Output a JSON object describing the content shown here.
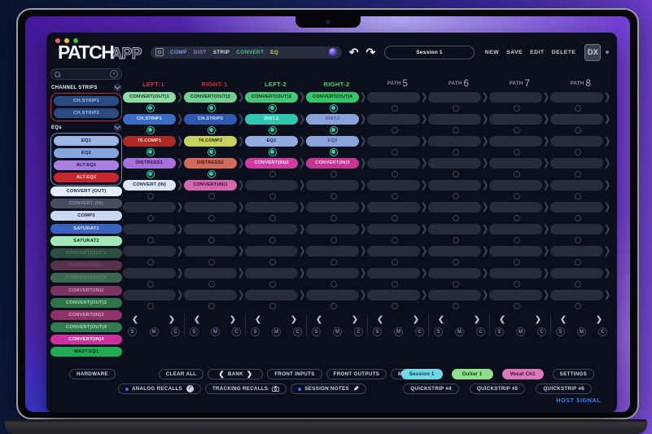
{
  "window": {
    "traffic_lights": [
      "#ff5f57",
      "#febc2e",
      "#28c840"
    ]
  },
  "icons": {
    "undo": "↶",
    "redo": "↷",
    "prev": "❮",
    "next": "❯",
    "clear_x": "✕",
    "pencil": "✎"
  },
  "header": {
    "logo_main": "PATCH",
    "logo_sub": "APP",
    "filter": {
      "tabs": [
        {
          "label": "COMP",
          "color": "#7f9ae6"
        },
        {
          "label": "DIST",
          "color": "#a86ae0"
        },
        {
          "label": "STRIP",
          "color": "#d2dee6"
        },
        {
          "label": "CONVERT",
          "color": "#3fc977"
        },
        {
          "label": "EQ",
          "color": "#d6d052"
        }
      ]
    },
    "session_name": "Session 1",
    "actions": [
      "NEW",
      "SAVE",
      "EDIT",
      "DELETE"
    ],
    "badge": "DX"
  },
  "sidebar": {
    "search_value": "",
    "groups": [
      {
        "label": "CHANNEL STRIPS",
        "border": "#b2333e",
        "items": [
          {
            "label": "CH.STRIP1",
            "bg": "#2b4a80",
            "fg": "#aabce0"
          },
          {
            "label": "CH.STRIP2",
            "bg": "#2b4a80",
            "fg": "#aabce0"
          }
        ]
      },
      {
        "label": "EQs",
        "border": "#6d87c8",
        "items": [
          {
            "label": "EQ1",
            "bg": "#9cb6e8",
            "fg": "#141c30"
          },
          {
            "label": "EQ2",
            "bg": "#88a4dc",
            "fg": "#141c30"
          },
          {
            "label": "ALT.EQ1",
            "bg": "#a77fe0",
            "fg": "#20103a"
          },
          {
            "label": "ALT.EQ2",
            "bg": "#c2282e",
            "fg": "#ffe2e2"
          }
        ]
      }
    ],
    "items": [
      {
        "label": "CONVERT (OUT)",
        "bg": "#e6ecfa",
        "fg": "#1a2030"
      },
      {
        "label": "CONVERT (IN)",
        "bg": "#474c5e",
        "fg": "#8a90a4"
      },
      {
        "label": "COMP2",
        "bg": "#ccd8f2",
        "fg": "#1a2030"
      },
      {
        "label": "SATURAT1",
        "bg": "#3a62c2",
        "fg": "#e8eeff"
      },
      {
        "label": "SATURAT2",
        "bg": "#a2e8b8",
        "fg": "#173020"
      },
      {
        "label": "CONVERT(OUT)1",
        "bg": "#2c4e3e",
        "fg": "#4e7a62"
      },
      {
        "label": "CONVERT(IN)1",
        "bg": "#57304a",
        "fg": "#7e4a68"
      },
      {
        "label": "CONVERT(OUT)2",
        "bg": "#3c6650",
        "fg": "#5e8a70"
      },
      {
        "label": "CONVERT(IN)2",
        "bg": "#7e3263",
        "fg": "#c898b4"
      },
      {
        "label": "CONVERT(OUT)3",
        "bg": "#2e7448",
        "fg": "#a8d8bc"
      },
      {
        "label": "CONVERT(IN)3",
        "bg": "#8e3268",
        "fg": "#d8a8c4"
      },
      {
        "label": "CONVERT(OUT)4",
        "bg": "#347a50",
        "fg": "#b0dcc0"
      },
      {
        "label": "CONVERT(IN)4",
        "bg": "#ce2f9e",
        "fg": "#ffffff"
      },
      {
        "label": "MAST.EQ1",
        "bg": "#22ab55",
        "fg": "#08281a"
      }
    ]
  },
  "grid": {
    "rows": 10,
    "nav_prev": "❮",
    "nav_next": "❯",
    "smc": [
      "S",
      "M",
      "C"
    ],
    "led_color": "#2bd0a6",
    "columns": [
      {
        "header": "LEFT-1",
        "color": "#c5333f",
        "leds_on": 4,
        "slots": [
          {
            "label": "CONVERT(OUT)1",
            "bg": "#8cdca4",
            "fg": "#16351f"
          },
          {
            "label": "CH.STRIP1",
            "bg": "#3a6cc4",
            "fg": "#e6eeff"
          },
          {
            "label": "76.COMP1",
            "bg": "#ad2a26",
            "fg": "#ffdada"
          },
          {
            "label": "DISTRESS1",
            "bg": "#a671dc",
            "fg": "#2a1145"
          },
          {
            "label": "CONVERT (IN)",
            "bg": "#dce4f6",
            "fg": "#1c2335"
          }
        ]
      },
      {
        "header": "RIGHT-1",
        "color": "#c5333f",
        "leds_on": 4,
        "slots": [
          {
            "label": "CONVERT(OUT)2",
            "bg": "#73d291",
            "fg": "#123019"
          },
          {
            "label": "CH.STRIP2",
            "bg": "#2e59ae",
            "fg": "#dce8ff"
          },
          {
            "label": "76.COMP2",
            "bg": "#c6d25c",
            "fg": "#2a2e10"
          },
          {
            "label": "DISTRESS2",
            "bg": "#d16b5b",
            "fg": "#3c120b"
          },
          {
            "label": "CONVERT(IN)1",
            "bg": "#d468b0",
            "fg": "#3c0c2a"
          }
        ]
      },
      {
        "header": "LEFT-2",
        "color": "#53c97b",
        "leds_on": 3,
        "slots": [
          {
            "label": "CONVERT(OUT)3",
            "bg": "#48c877",
            "fg": "#0b2a17"
          },
          {
            "label": "DIST.1",
            "bg": "#2ec7b2",
            "fg": "#eafffb"
          },
          {
            "label": "EQ1",
            "bg": "#92abe0",
            "fg": "#182342"
          },
          {
            "label": "CONVERT(IN)2",
            "bg": "#cf3ba0",
            "fg": "#ffe2f4"
          }
        ]
      },
      {
        "header": "RIGHT-2",
        "color": "#53c97b",
        "leds_on": 3,
        "slots": [
          {
            "label": "CONVERT(OUT)4",
            "bg": "#37c569",
            "fg": "#0a2a16"
          },
          {
            "label": "DIST.2",
            "bg": "#8aa2da",
            "fg": "#47598e"
          },
          {
            "label": "EQ2",
            "bg": "#8ca4dc",
            "fg": "#3d4f85"
          },
          {
            "label": "CONVERT(IN)3",
            "bg": "#c2368f",
            "fg": "#ffd9ee"
          }
        ]
      },
      {
        "header_prefix": "PATH",
        "header_num": "5",
        "leds_on": 0,
        "slots": []
      },
      {
        "header_prefix": "PATH",
        "header_num": "6",
        "leds_on": 0,
        "slots": []
      },
      {
        "header_prefix": "PATH",
        "header_num": "7",
        "leds_on": 0,
        "slots": []
      },
      {
        "header_prefix": "PATH",
        "header_num": "8",
        "leds_on": 0,
        "slots": []
      }
    ]
  },
  "bottom": {
    "left_row1": [
      {
        "label": "HARDWARE"
      },
      {
        "label": "CLEAR ALL",
        "gap_before": 48
      },
      {
        "label": "BANK",
        "arrows": true
      },
      {
        "label": "FRONT INPUTS"
      },
      {
        "label": "FRONT OUTPUTS"
      },
      {
        "label": "MUTE ALL"
      }
    ],
    "left_row2": [
      {
        "label": "ANALOG RECALLS",
        "dot": true,
        "icon": "knob"
      },
      {
        "label": "TRACKING RECALLS",
        "icon": "camera"
      },
      {
        "label": "SESSION NOTES",
        "dot": true,
        "icon": "pencil"
      }
    ],
    "right_row1": [
      {
        "label": "Session 1",
        "bg": "#6fd9e8",
        "fg": "#0c3038"
      },
      {
        "label": "Guitar 1",
        "bg": "#8ee08a",
        "fg": "#12300f"
      },
      {
        "label": "Vocal Ch1",
        "bg": "#d978ba",
        "fg": "#38082a"
      },
      {
        "label": "SETTINGS",
        "outline": true
      }
    ],
    "right_row2": [
      {
        "label": "QUICKSTRIP #4"
      },
      {
        "label": "QUICKSTRIP #5"
      },
      {
        "label": "QUICKSTRIP #6"
      }
    ],
    "status": "HOST SIGNAL"
  }
}
